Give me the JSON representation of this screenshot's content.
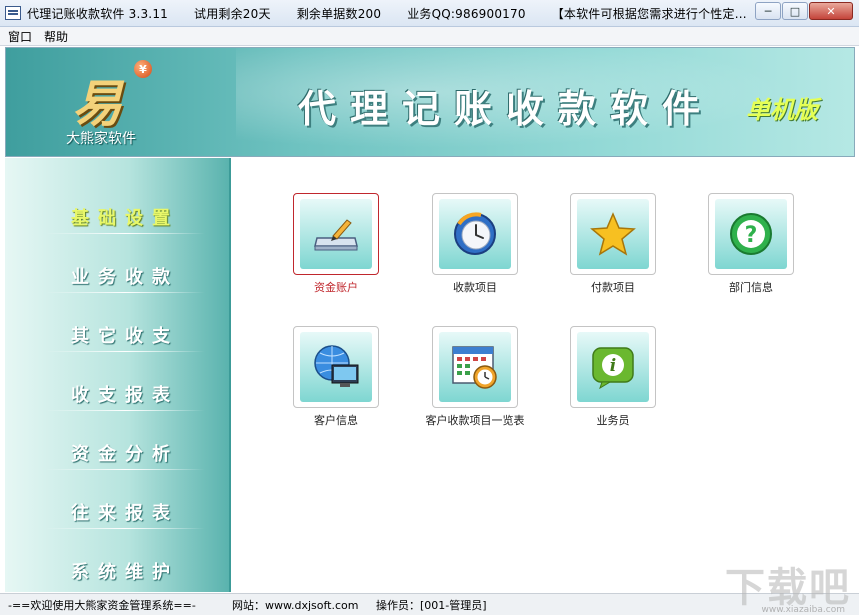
{
  "window": {
    "title_parts": [
      "代理记账收款软件 3.3.11",
      "试用剩余20天",
      "剩余单据数200",
      "业务QQ:986900170",
      "【本软件可根据您需求进行个性定..."
    ],
    "minimize": "─",
    "restore": "□",
    "close": "✕"
  },
  "menu": [
    "窗口",
    "帮助"
  ],
  "banner": {
    "logo_mark": "易",
    "logo_coin": "¥",
    "logo_caption": "大熊家软件",
    "title": "代理记账收款软件",
    "badge": "单机版"
  },
  "sidebar": {
    "items": [
      {
        "label": "基础设置",
        "active": true
      },
      {
        "label": "业务收款",
        "active": false
      },
      {
        "label": "其它收支",
        "active": false
      },
      {
        "label": "收支报表",
        "active": false
      },
      {
        "label": "资金分析",
        "active": false
      },
      {
        "label": "往来报表",
        "active": false
      },
      {
        "label": "系统维护",
        "active": false
      }
    ]
  },
  "tiles": [
    {
      "label": "资金账户",
      "icon": "account-icon",
      "selected": true
    },
    {
      "label": "收款项目",
      "icon": "clock-icon",
      "selected": false
    },
    {
      "label": "付款项目",
      "icon": "star-icon",
      "selected": false
    },
    {
      "label": "部门信息",
      "icon": "help-icon",
      "selected": false
    },
    {
      "label": "客户信息",
      "icon": "globe-monitor-icon",
      "selected": false
    },
    {
      "label": "客户收款项目一览表",
      "icon": "calendar-clock-icon",
      "selected": false
    },
    {
      "label": "业务员",
      "icon": "info-icon",
      "selected": false
    }
  ],
  "statusbar": {
    "welcome": "-==欢迎使用大熊家资金管理系统==-",
    "website": "网站：www.dxjsoft.com",
    "operator": "操作员：[001-管理员]"
  },
  "watermark": {
    "text": "下载吧",
    "sub": "www.xiazaiba.com"
  }
}
